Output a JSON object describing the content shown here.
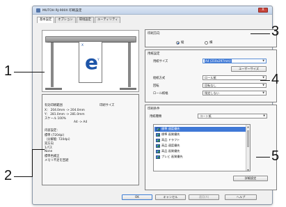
{
  "window": {
    "title": "MUTOH RJ-900X 印刷設定",
    "close_label": "X"
  },
  "tabs": [
    "基本設定",
    "オプション",
    "環境設定",
    "ユーティリティ"
  ],
  "preview": {
    "glyph": "e",
    "marker_x": "X",
    "marker_y": "Y"
  },
  "info": {
    "heading": "有効印刷範囲",
    "print_size_label": "印刷サイズ",
    "x_line": "X：  204.0mm  ->    204.0mm",
    "y_line": "Y：  281.0mm  ->    281.0mm",
    "scale": "スケール  100%",
    "paper_map": "A4  ->  A4",
    "content_heading": "内容設定：",
    "lines": [
      "標準 (720dpi)",
      "（分解能: 720dpi）",
      "双方向",
      "1パス",
      "None",
      "標準色補正",
      "メモリ不足を回避"
    ]
  },
  "orientation": {
    "group_label": "印刷方向",
    "portrait": "縦",
    "landscape": "横",
    "selected": "portrait"
  },
  "paper": {
    "group_label": "用紙設定",
    "size_label": "用紙サイズ",
    "size_value": "A4 (210x297mm)",
    "user_size_button": "ユーザーサイズ",
    "feed_label": "給紙方式",
    "feed_value": "ロール紙",
    "rotate_label": "回転",
    "rotate_value": "回転なし",
    "roll_width_label": "ロール紙幅",
    "roll_width_value": "指定しない"
  },
  "print_conditions": {
    "group_label": "印刷条件",
    "media_label": "用紙種類",
    "media_value": "コート紙",
    "modes": [
      "標準  速度優先",
      "標準  画質優先",
      "高品  ドラフト",
      "高品  速度優先",
      "高品  画質優先",
      "プレビ  画質優先"
    ],
    "selected_index": 0,
    "details_button": "詳細設定"
  },
  "footer": {
    "ok": "OK",
    "cancel": "キャンセル",
    "apply": "適用(A)",
    "help": "ヘルプ"
  },
  "callouts": [
    "1",
    "2",
    "3",
    "4",
    "5"
  ],
  "colors": {
    "accent": "#3f78d6",
    "preview_glyph": "#1e55a8"
  }
}
